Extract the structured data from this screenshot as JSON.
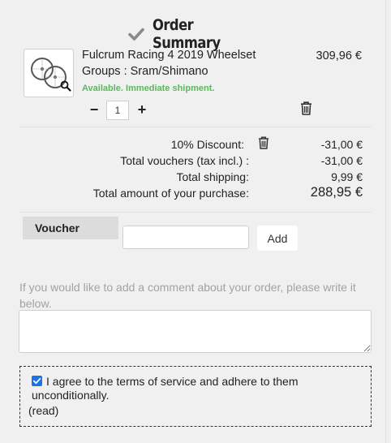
{
  "header": {
    "title": "Order Summary",
    "icon": "checkmark-icon"
  },
  "product": {
    "name": "Fulcrum Racing 4 2019 Wheelset",
    "group": "Groups : Sram/Shimano",
    "availability": "Available. Immediate shipment.",
    "price": "309,96 €",
    "quantity": "1",
    "minus_label": "−",
    "plus_label": "+",
    "image_icon": "wheelset-image",
    "zoom_icon": "magnifier-icon",
    "remove_icon": "trash-icon"
  },
  "summary": {
    "discount_label": "10% Discount:",
    "discount_value": "-31,00 €",
    "vouchers_label": "Total vouchers  (tax incl.) :",
    "vouchers_value": "-31,00 €",
    "shipping_label": "Total shipping:",
    "shipping_value": "9,99 €",
    "total_label": "Total amount of your purchase:",
    "total_value": "288,95 €"
  },
  "voucher": {
    "label": "Voucher",
    "input_value": "",
    "add_label": "Add"
  },
  "comment": {
    "prompt": "If you would like to add a comment about your order, please write it below.",
    "value": ""
  },
  "terms": {
    "checked": true,
    "text": "I agree to the terms of service and adhere to them unconditionally.",
    "read_label": "(read)"
  },
  "colors": {
    "background": "#f0f0f0",
    "available": "#5cb85c",
    "checkbox": "#1a73e8",
    "check_icon": "#8a8a8a"
  }
}
